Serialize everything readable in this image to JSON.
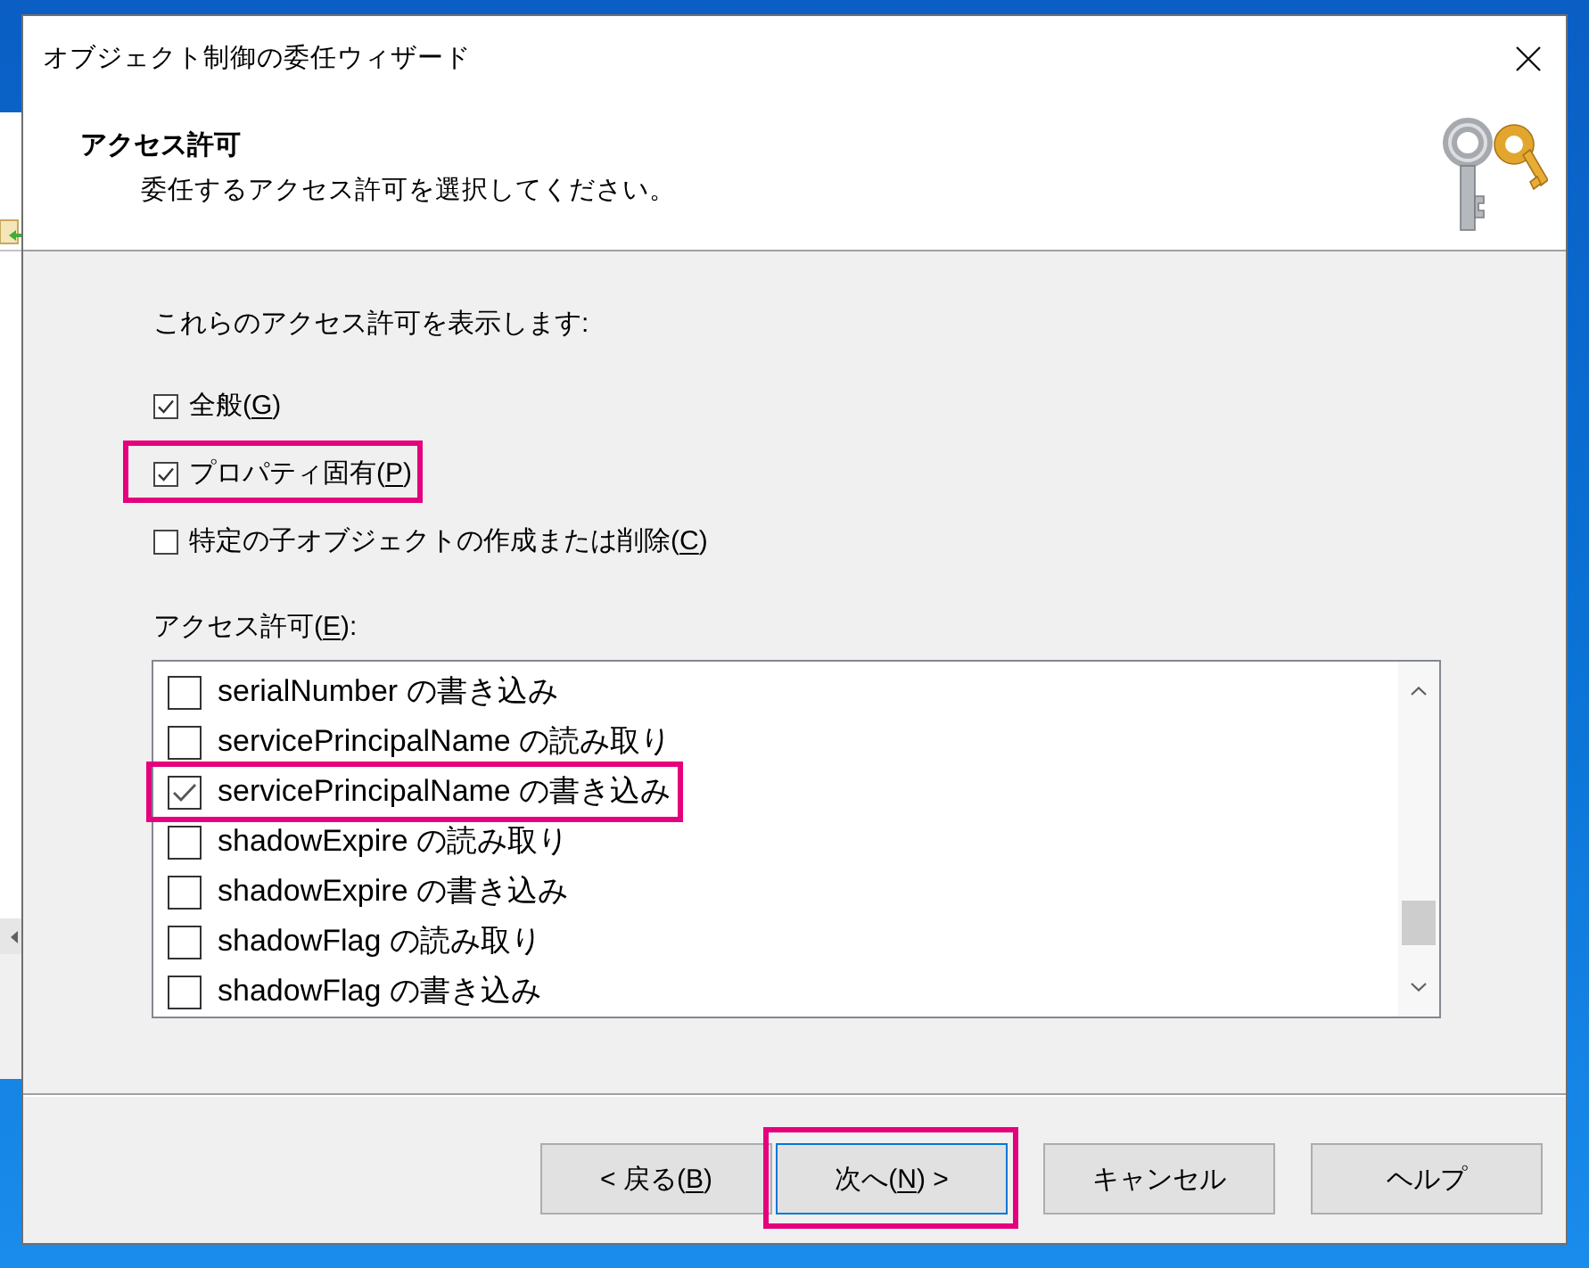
{
  "window": {
    "title": "オブジェクト制御の委任ウィザード"
  },
  "header": {
    "title": "アクセス許可",
    "subtitle": "委任するアクセス許可を選択してください。"
  },
  "show_permissions": {
    "label": "これらのアクセス許可を表示します:",
    "options": [
      {
        "label": [
          {
            "text": "全般(",
            "underline": false
          },
          {
            "text": "G",
            "underline": true
          },
          {
            "text": ")",
            "underline": false
          }
        ],
        "checked": true,
        "highlighted": false
      },
      {
        "label": [
          {
            "text": "プロパティ固有(",
            "underline": false
          },
          {
            "text": "P",
            "underline": true
          },
          {
            "text": ")",
            "underline": false
          }
        ],
        "checked": true,
        "highlighted": true
      },
      {
        "label": [
          {
            "text": "特定の子オブジェクトの作成または削除(",
            "underline": false
          },
          {
            "text": "C",
            "underline": true
          },
          {
            "text": ")",
            "underline": false
          }
        ],
        "checked": false,
        "highlighted": false
      }
    ]
  },
  "permissions": {
    "label": [
      {
        "text": "アクセス許可(",
        "underline": false
      },
      {
        "text": "E",
        "underline": true
      },
      {
        "text": "):",
        "underline": false
      }
    ],
    "items": [
      {
        "label": "serialNumber の書き込み",
        "checked": false,
        "highlighted": false
      },
      {
        "label": "servicePrincipalName の読み取り",
        "checked": false,
        "highlighted": false
      },
      {
        "label": "servicePrincipalName の書き込み",
        "checked": true,
        "highlighted": true
      },
      {
        "label": "shadowExpire の読み取り",
        "checked": false,
        "highlighted": false
      },
      {
        "label": "shadowExpire の書き込み",
        "checked": false,
        "highlighted": false
      },
      {
        "label": "shadowFlag の読み取り",
        "checked": false,
        "highlighted": false
      },
      {
        "label": "shadowFlag の書き込み",
        "checked": false,
        "highlighted": false
      }
    ]
  },
  "buttons": [
    {
      "label": [
        {
          "text": "< 戻る(",
          "underline": false
        },
        {
          "text": "B",
          "underline": true
        },
        {
          "text": ")",
          "underline": false
        }
      ],
      "default": false,
      "highlighted": false
    },
    {
      "label": [
        {
          "text": "次へ(",
          "underline": false
        },
        {
          "text": "N",
          "underline": true
        },
        {
          "text": ") >",
          "underline": false
        }
      ],
      "default": true,
      "highlighted": true
    },
    {
      "label": [
        {
          "text": "キャンセル",
          "underline": false
        }
      ],
      "default": false,
      "highlighted": false
    },
    {
      "label": [
        {
          "text": "ヘルプ",
          "underline": false
        }
      ],
      "default": false,
      "highlighted": false
    }
  ]
}
